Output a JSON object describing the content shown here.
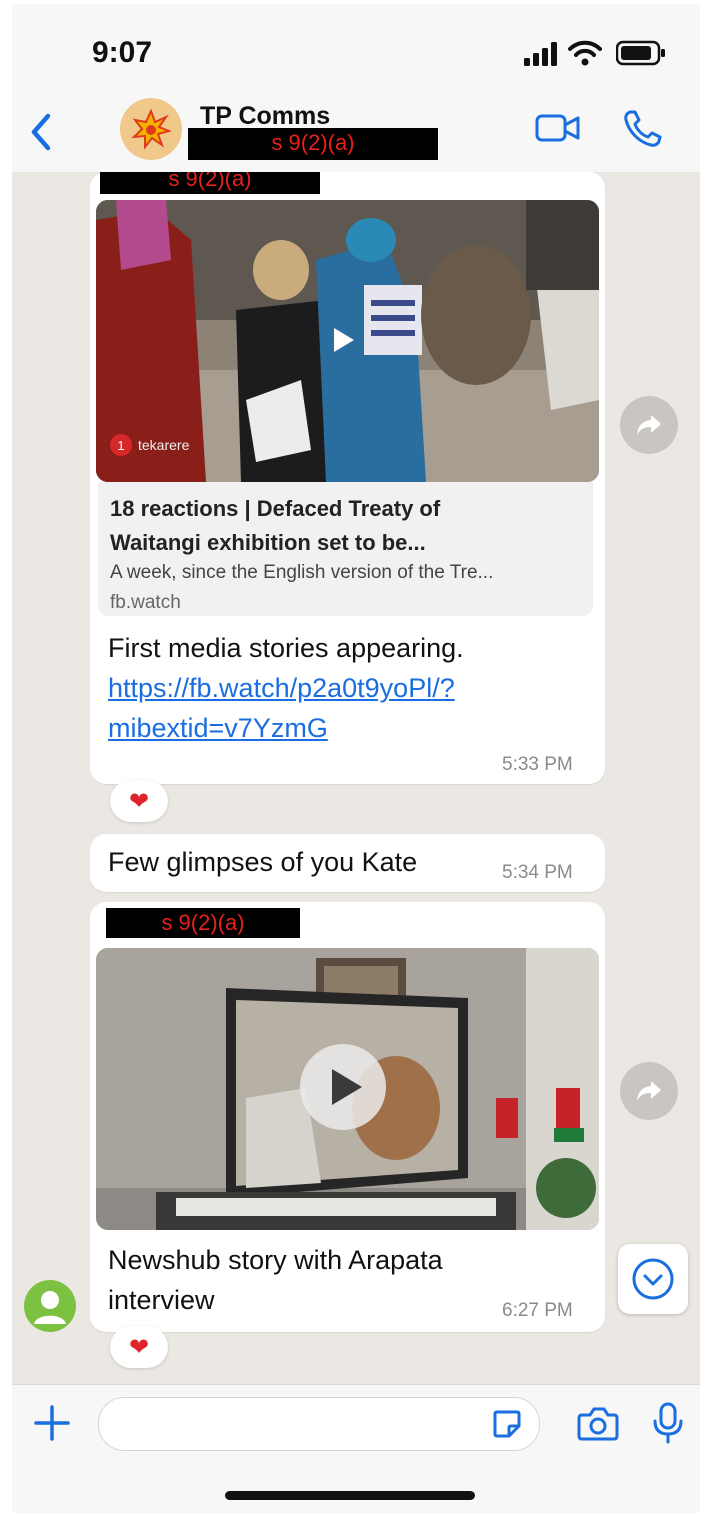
{
  "status_bar": {
    "time": "9:07"
  },
  "header": {
    "contact_name": "TP Comms",
    "redaction_label": "s 9(2)(a)"
  },
  "messages": [
    {
      "sender_redaction": "s 9(2)(a)",
      "link_preview": {
        "video_watermark": "tekarere",
        "title": "18 reactions | Defaced Treaty of Waitangi exhibition set to be...",
        "title_line1": "18 reactions | Defaced Treaty of",
        "title_line2": "Waitangi exhibition set to be...",
        "description": "A week, since the English version of the Tre...",
        "domain": "fb.watch"
      },
      "text": "First media stories appearing.",
      "url_line1": "https://fb.watch/p2a0t9yoPl/?",
      "url_line2": "mibextid=v7YzmG",
      "time": "5:33 PM",
      "reaction": "❤"
    },
    {
      "text": "Few glimpses of you Kate",
      "time": "5:34 PM"
    },
    {
      "sender_redaction": "s 9(2)(a)",
      "text_line1": "Newshub story with Arapata",
      "text_line2": "interview",
      "time": "6:27 PM",
      "reaction": "❤"
    }
  ],
  "icons": {
    "back": "chevron-left-icon",
    "video_call": "video-camera-icon",
    "voice_call": "phone-icon",
    "forward": "forward-icon",
    "scroll_down": "chevron-down-circle-icon",
    "attach": "plus-icon",
    "sticker": "sticker-icon",
    "camera": "camera-icon",
    "microphone": "microphone-icon"
  },
  "colors": {
    "accent": "#1a6ee0",
    "chat_background": "#ebe8e3",
    "bubble": "#ffffff",
    "redaction_text": "#e8201c",
    "heart": "#e0242c"
  }
}
